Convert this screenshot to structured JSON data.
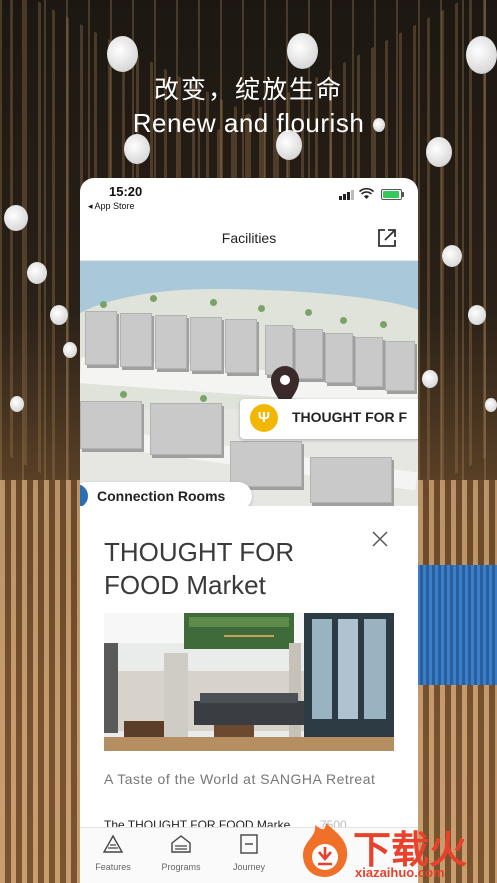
{
  "headline": {
    "chinese": "改变，绽放生命",
    "english": "Renew and flourish"
  },
  "status_bar": {
    "time": "15:20",
    "back_label": "◂ App Store"
  },
  "navbar": {
    "title": "Facilities",
    "action_icon": "external-link-icon"
  },
  "map": {
    "selected_label": "THOUGHT FOR F",
    "selected_icon": "fork-knife-icon",
    "other_label": "Connection Rooms"
  },
  "detail": {
    "title": "THOUGHT FOR FOOD Market",
    "subtitle": "A Taste of the World at SANGHA Retreat",
    "body": "The THOUGHT FOR FOOD Marke",
    "body_overlap": "7500",
    "close_icon": "close-icon"
  },
  "tabs": [
    {
      "label": "Features",
      "icon": "features-icon"
    },
    {
      "label": "Programs",
      "icon": "programs-icon"
    },
    {
      "label": "Journey",
      "icon": "journey-icon"
    }
  ],
  "watermark": {
    "text": "下载火",
    "url": "xiazaihuo.com"
  },
  "colors": {
    "accent_yellow": "#f2b705",
    "pin": "#3a2a2a",
    "watermark_red": "#e8412c"
  }
}
